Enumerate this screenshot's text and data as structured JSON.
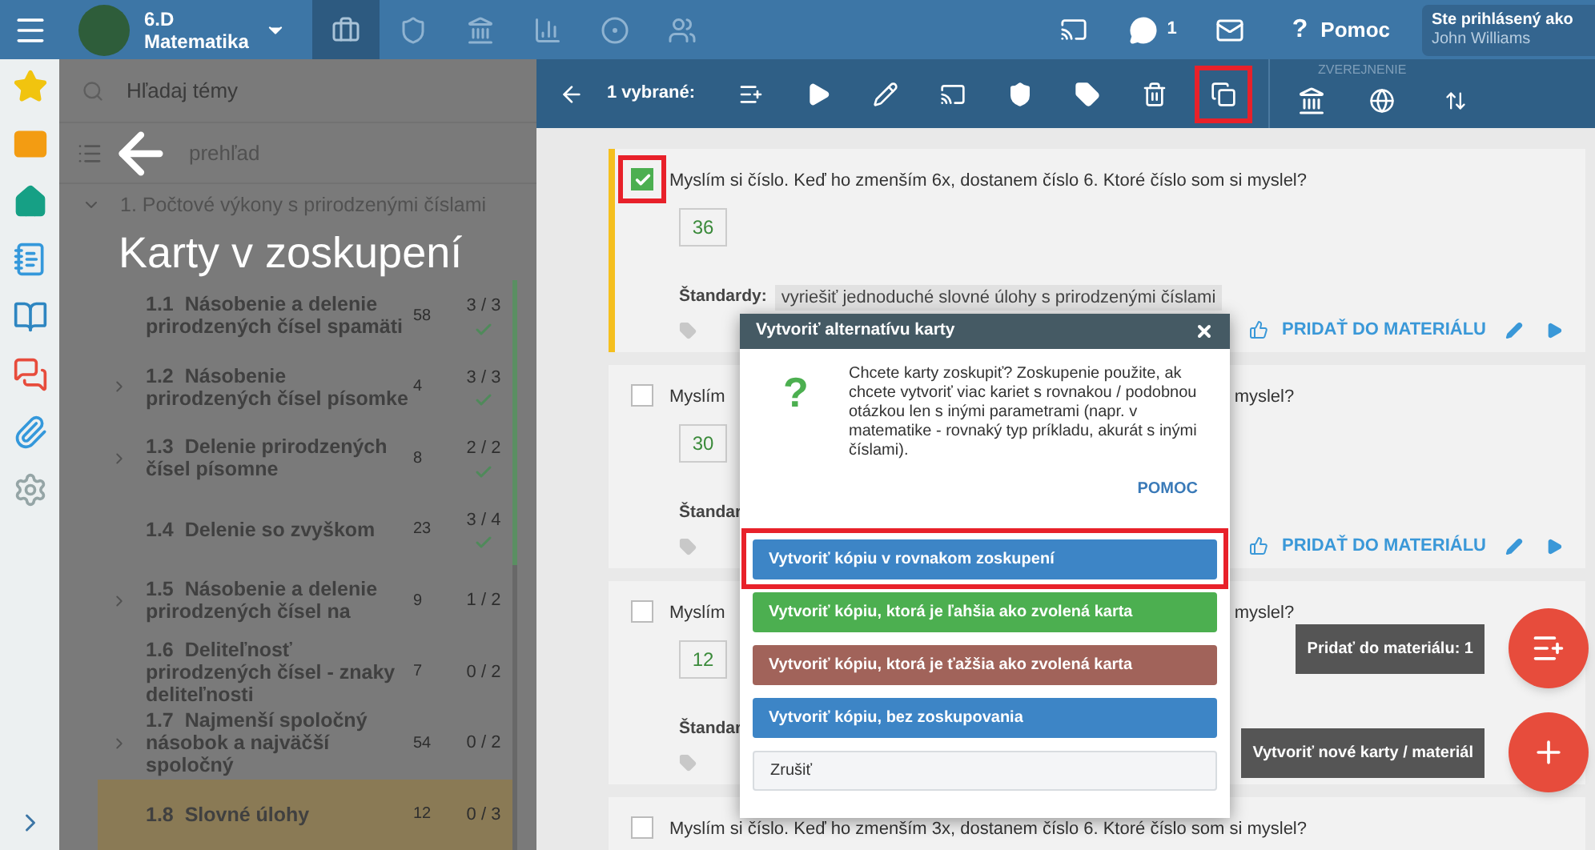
{
  "top_bar": {
    "class_name": "6.D",
    "subject": "Matematika",
    "nav_tabs": [
      {
        "selected": true
      },
      {
        "selected": false
      },
      {
        "selected": false
      },
      {
        "selected": false
      },
      {
        "selected": false
      },
      {
        "selected": false
      }
    ],
    "messages_count": "1",
    "help_glyph": "?",
    "help": "Pomoc",
    "user": {
      "label": "Ste prihlásený ako",
      "name": "John Williams"
    }
  },
  "rail": [
    {
      "selected": false
    },
    {
      "selected": false
    },
    {
      "selected": false
    },
    {
      "selected": false
    },
    {
      "selected": false
    },
    {
      "selected": false
    },
    {
      "selected": false
    },
    {
      "selected": false
    }
  ],
  "topic_panel": {
    "search_placeholder": "Hľadaj témy",
    "overview_label": "prehľad",
    "section": "1. Počtové výkony s prirodzenými číslami",
    "overlay_title": "Karty v zoskupení",
    "items": [
      {
        "number": "1.1",
        "title": "Násobenie a delenie prirodzených čísel spamäti",
        "count": "58",
        "progress": "3 / 3",
        "done": true,
        "expandable": false,
        "selected": false
      },
      {
        "number": "1.2",
        "title": "Násobenie prirodzených čísel písomke",
        "count": "4",
        "progress": "3 / 3",
        "done": true,
        "expandable": true,
        "selected": false
      },
      {
        "number": "1.3",
        "title": "Delenie prirodzených čísel písomne",
        "count": "8",
        "progress": "2 / 2",
        "done": true,
        "expandable": true,
        "selected": false
      },
      {
        "number": "1.4",
        "title": "Delenie so zvyškom",
        "count": "23",
        "progress": "3 / 4",
        "done": true,
        "expandable": false,
        "selected": false
      },
      {
        "number": "1.5",
        "title": "Násobenie a delenie prirodzených čísel na",
        "count": "9",
        "progress": "1 / 2",
        "done": false,
        "expandable": true,
        "selected": false
      },
      {
        "number": "1.6",
        "title": "Deliteľnosť prirodzených čísel - znaky deliteľnosti",
        "count": "7",
        "progress": "0 / 2",
        "done": false,
        "expandable": false,
        "selected": false
      },
      {
        "number": "1.7",
        "title": "Najmenší spoločný násobok a najväčší spoločný",
        "count": "54",
        "progress": "0 / 2",
        "done": false,
        "expandable": true,
        "selected": false
      },
      {
        "number": "1.8",
        "title": "Slovné úlohy",
        "count": "12",
        "progress": "0 / 3",
        "done": false,
        "expandable": false,
        "selected": true
      }
    ]
  },
  "toolbar": {
    "selected_label": "1 vybrané:",
    "publish_label": "ZVEREJNENIE",
    "copy_highlighted": true
  },
  "cards": [
    {
      "selected": true,
      "highlighted": true,
      "question": [
        "Myslím si číslo. Keď ho zmenším 6x, dostanem číslo 6. Ktoré číslo som si myslel?"
      ],
      "answer": "36",
      "standards_label": "Štandardy:",
      "standard": "vyriešiť jednoduché slovné úlohy s prirodzenými číslami",
      "add_label": "PRIDAŤ DO MATERIÁLU"
    },
    {
      "selected": false,
      "highlighted": false,
      "question": [
        "Myslím",
        "myslel?"
      ],
      "answer": "30",
      "standards_label": "Štandar",
      "add_label": "PRIDAŤ DO MATERIÁLU"
    },
    {
      "selected": false,
      "highlighted": false,
      "question": [
        "Myslím",
        "myslel?"
      ],
      "answer": "12",
      "standards_label": "Štandar"
    },
    {
      "selected": false,
      "highlighted": false,
      "question": [
        "Myslím si číslo. Keď ho zmenším 3x, dostanem číslo 6. Ktoré číslo som si myslel?"
      ]
    }
  ],
  "dialog": {
    "title": "Vytvoriť alternatívu karty",
    "glyph": "?",
    "text": "Chcete karty zoskupiť? Zoskupenie použite, ak chcete vytvoriť viac kariet s rovnakou / podobnou otázkou len s inými parametrami (napr. v matematike - rovnaký typ príkladu, akurát s inými číslami).",
    "help": "POMOC",
    "options": [
      {
        "label": "Vytvoriť kópiu v rovnakom zoskupení",
        "kind": "primary",
        "highlighted": true
      },
      {
        "label": "Vytvoriť kópiu, ktorá je ľahšia ako zvolená karta",
        "kind": "easier",
        "highlighted": false
      },
      {
        "label": "Vytvoriť kópiu, ktorá je ťažšia ako zvolená karta",
        "kind": "harder",
        "highlighted": false
      },
      {
        "label": "Vytvoriť kópiu, bez zoskupovania",
        "kind": "primary",
        "highlighted": false
      },
      {
        "label": "Zrušiť",
        "kind": "cancel",
        "highlighted": false
      }
    ]
  },
  "fabs": [
    {
      "tooltip": "Pridať do materiálu: 1",
      "kind": "add-to-material"
    },
    {
      "tooltip": "Vytvoriť nové karty / materiál",
      "kind": "create"
    }
  ]
}
